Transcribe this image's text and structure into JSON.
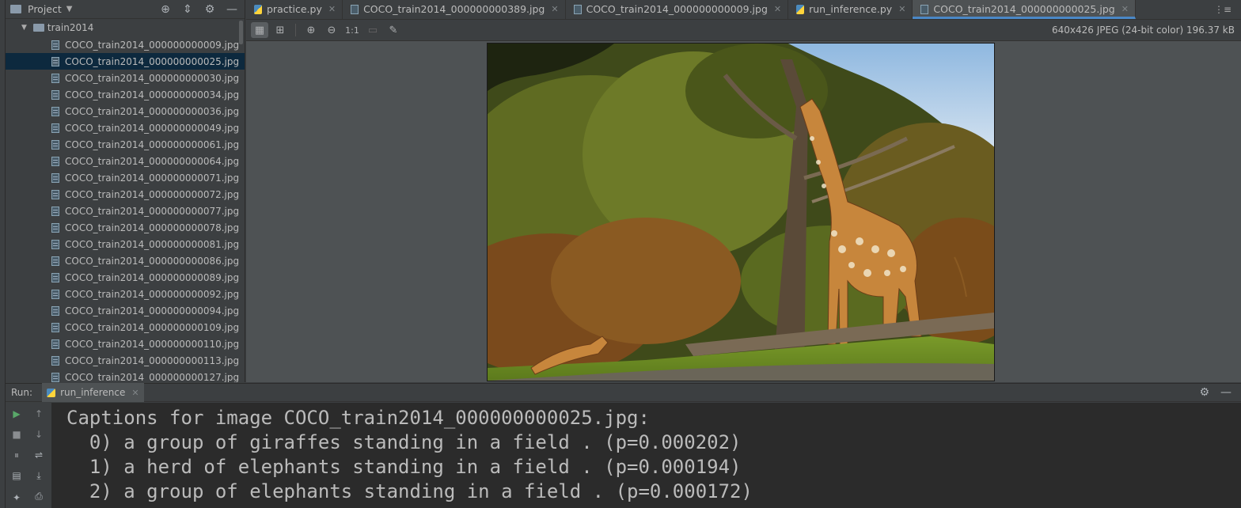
{
  "project": {
    "title": "Project",
    "root_folder": "train2014",
    "files": [
      "COCO_train2014_000000000009.jpg",
      "COCO_train2014_000000000025.jpg",
      "COCO_train2014_000000000030.jpg",
      "COCO_train2014_000000000034.jpg",
      "COCO_train2014_000000000036.jpg",
      "COCO_train2014_000000000049.jpg",
      "COCO_train2014_000000000061.jpg",
      "COCO_train2014_000000000064.jpg",
      "COCO_train2014_000000000071.jpg",
      "COCO_train2014_000000000072.jpg",
      "COCO_train2014_000000000077.jpg",
      "COCO_train2014_000000000078.jpg",
      "COCO_train2014_000000000081.jpg",
      "COCO_train2014_000000000086.jpg",
      "COCO_train2014_000000000089.jpg",
      "COCO_train2014_000000000092.jpg",
      "COCO_train2014_000000000094.jpg",
      "COCO_train2014_000000000109.jpg",
      "COCO_train2014_000000000110.jpg",
      "COCO_train2014_000000000113.jpg",
      "COCO_train2014_000000000127.jpg"
    ],
    "selected_file": "COCO_train2014_000000000025.jpg"
  },
  "editor": {
    "tabs": [
      {
        "label": "practice.py",
        "icon": "python-file-icon"
      },
      {
        "label": "COCO_train2014_000000000389.jpg",
        "icon": "image-file-icon"
      },
      {
        "label": "COCO_train2014_000000000009.jpg",
        "icon": "image-file-icon"
      },
      {
        "label": "run_inference.py",
        "icon": "python-file-icon"
      },
      {
        "label": "COCO_train2014_000000000025.jpg",
        "icon": "image-file-icon"
      }
    ],
    "active_tab": "COCO_train2014_000000000025.jpg",
    "image_toolbar": {
      "actual_size_label": "1:1",
      "image_info": "640x426 JPEG (24-bit color) 196.37 kB"
    }
  },
  "run": {
    "label": "Run:",
    "tab_label": "run_inference",
    "console_lines": [
      "Captions for image COCO_train2014_000000000025.jpg:",
      "  0) a group of giraffes standing in a field . (p=0.000202)",
      "  1) a herd of elephants standing in a field . (p=0.000194)",
      "  2) a group of elephants standing in a field . (p=0.000172)"
    ]
  },
  "colors": {
    "accent": "#4a88c7",
    "selection": "#0d293e",
    "console_bg": "#2b2b2b",
    "panel_bg": "#3c3f41"
  }
}
